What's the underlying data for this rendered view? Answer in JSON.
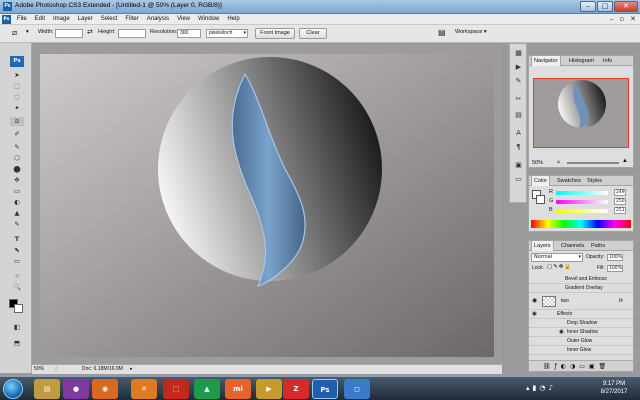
{
  "window": {
    "title": "Adobe Photoshop CS3 Extended - [Untitled-1 @ 50% (Layer 0, RGB/8)]",
    "app_icon": "Ps",
    "min": "–",
    "max": "□",
    "close": "✕"
  },
  "menubar": {
    "badge": "Ps",
    "items": [
      "File",
      "Edit",
      "Image",
      "Layer",
      "Select",
      "Filter",
      "Analysis",
      "View",
      "Window",
      "Help"
    ],
    "right_min": "–",
    "right_restore": "▫",
    "right_close": "✕"
  },
  "options": {
    "width_label": "Width:",
    "width_value": "",
    "height_label": "Height:",
    "height_value": "",
    "resolution_label": "Resolution:",
    "resolution_value": "300",
    "resolution_unit": "pixels/inch",
    "front_image": "Front Image",
    "clear": "Clear",
    "workspace": "Workspace ▾"
  },
  "toolbox": {
    "logo": "Ps",
    "tools": [
      "➤",
      "⬚",
      "◌",
      "✦",
      "⧄",
      "✐",
      "✎",
      "⬡",
      "⬤",
      "✥",
      "▭",
      "◐",
      "▲",
      "✎",
      "T",
      "⬉",
      "▭",
      "☜",
      "🔍",
      "◼",
      "◧",
      "⬒"
    ]
  },
  "canvas": {
    "bg_top": "#d6d2d2",
    "bg_bottom": "#6e6a6a",
    "sphere_light": "#f0f0f0",
    "sphere_dark": "#1b1b1b",
    "stroke_color": "#5e83ab"
  },
  "status": {
    "zoom": "50%",
    "doc": "Doc: 6.18M/16.9M"
  },
  "navigator": {
    "tabs": [
      "Navigator",
      "Histogram",
      "Info"
    ],
    "zoom": "50%"
  },
  "color": {
    "tabs": [
      "Color",
      "Swatches",
      "Styles"
    ],
    "channels": [
      {
        "label": "R",
        "value": "249"
      },
      {
        "label": "G",
        "value": "250"
      },
      {
        "label": "B",
        "value": "251"
      }
    ]
  },
  "layers": {
    "tabs": [
      "Layers",
      "Channels",
      "Paths"
    ],
    "blend_mode": "Normal",
    "opacity_label": "Opacity:",
    "opacity_value": "100%",
    "lock_label": "Lock:",
    "fill_label": "Fill:",
    "fill_value": "100%",
    "rows": [
      {
        "name": "Bevel and Emboss",
        "indent": 1
      },
      {
        "name": "Gradient Overlay",
        "indent": 1
      },
      {
        "name": "two",
        "indent": 0,
        "fx": "fx"
      },
      {
        "name": "Effects",
        "indent": 1
      },
      {
        "name": "Drop Shadow",
        "indent": 2
      },
      {
        "name": "Inner Shadow",
        "indent": 2
      },
      {
        "name": "Outer Glow",
        "indent": 2
      },
      {
        "name": "Inner Glow",
        "indent": 2
      }
    ]
  },
  "taskbar": {
    "apps": [
      {
        "name": "file-explorer",
        "glyph": "▤",
        "color": "#c29a3f"
      },
      {
        "name": "media-player",
        "glyph": "●",
        "color": "#7f3aa0"
      },
      {
        "name": "firefox",
        "glyph": "◉",
        "color": "#d86a1f"
      },
      {
        "name": "xampp",
        "glyph": "✕",
        "color": "#e07a1f"
      },
      {
        "name": "acrobat",
        "glyph": "⬚",
        "color": "#c2291c"
      },
      {
        "name": "green-app",
        "glyph": "▲",
        "color": "#1d9a4a"
      },
      {
        "name": "mi-app",
        "glyph": "mi",
        "color": "#e8632a"
      },
      {
        "name": "video-app",
        "glyph": "▶",
        "color": "#c89a2a"
      },
      {
        "name": "red-app",
        "glyph": "Z",
        "color": "#d42a2a"
      },
      {
        "name": "photoshop",
        "glyph": "Ps",
        "color": "#1e5fae"
      },
      {
        "name": "blue-app",
        "glyph": "◻",
        "color": "#3a7ac8"
      }
    ],
    "time": "9:17 PM",
    "date": "8/27/2017"
  }
}
